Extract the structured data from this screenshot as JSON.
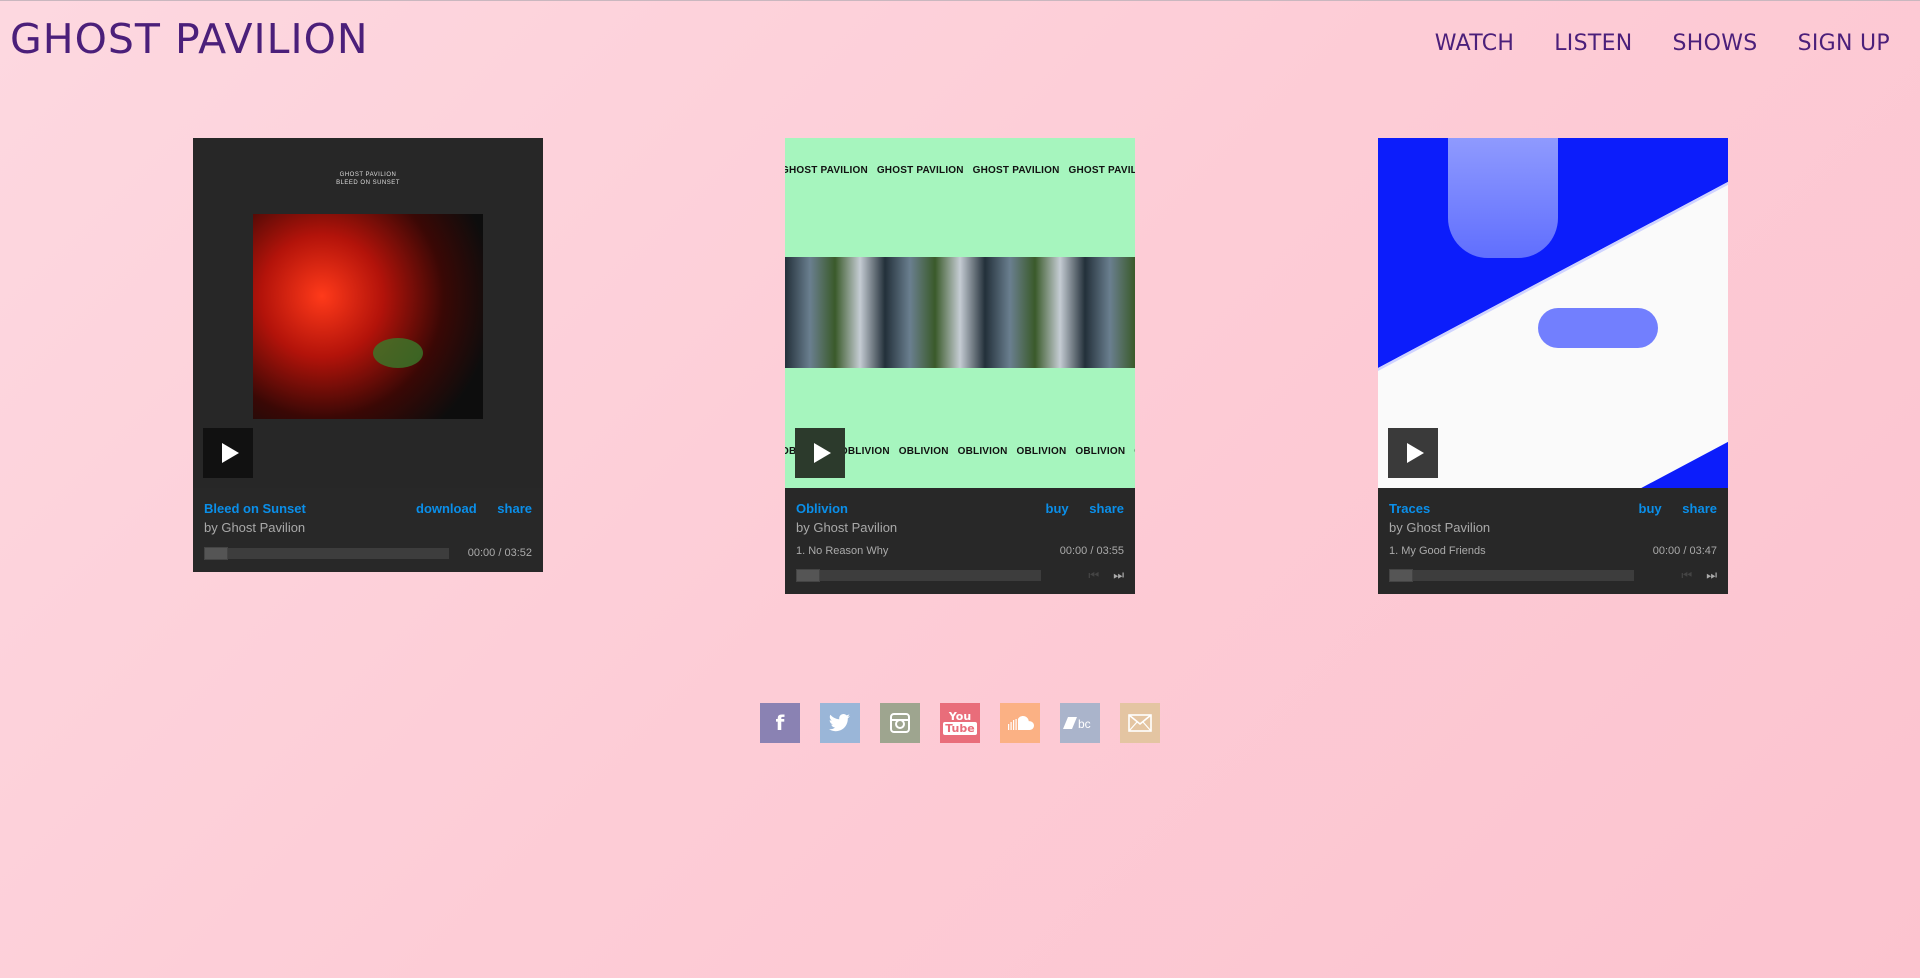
{
  "header": {
    "title": "GHOST PAVILION",
    "nav": [
      "WATCH",
      "LISTEN",
      "SHOWS",
      "SIGN UP"
    ]
  },
  "players": [
    {
      "album": "Bleed on Sunset",
      "art_text": [
        "GHOST PAVILION",
        "BLEED ON SUNSET"
      ],
      "artist": "by Ghost Pavilion",
      "action1": "download",
      "action2": "share",
      "time": "00:00 / 03:52",
      "progress": 0
    },
    {
      "album": "Oblivion",
      "art_text": [
        "GHOST PAVILION",
        "OBLIVION"
      ],
      "artist": "by Ghost Pavilion",
      "action1": "buy",
      "action2": "share",
      "track": "1.  No Reason Why",
      "time": "00:00 / 03:55",
      "progress": 0
    },
    {
      "album": "Traces",
      "artist": "by Ghost Pavilion",
      "action1": "buy",
      "action2": "share",
      "track": "1.  My Good Friends",
      "time": "00:00 / 03:47",
      "progress": 0
    }
  ],
  "social": [
    {
      "name": "facebook-icon",
      "glyph": "f",
      "color": "#8a82b3"
    },
    {
      "name": "twitter-icon",
      "glyph": "🐦",
      "color": "#9ab6d8"
    },
    {
      "name": "instagram-icon",
      "glyph": "▣",
      "color": "#9ea58f"
    },
    {
      "name": "youtube-icon",
      "glyph": "You",
      "color": "#e96d7a"
    },
    {
      "name": "soundcloud-icon",
      "glyph": "☁",
      "color": "#fbb184"
    },
    {
      "name": "bandcamp-icon",
      "glyph": "bc",
      "color": "#aab4cb"
    },
    {
      "name": "email-icon",
      "glyph": "✉",
      "color": "#e4c5a2"
    }
  ],
  "colors": {
    "accent_link": "#0a8fea",
    "title_purple": "#4b1f7a",
    "player_bg": "#282828"
  }
}
